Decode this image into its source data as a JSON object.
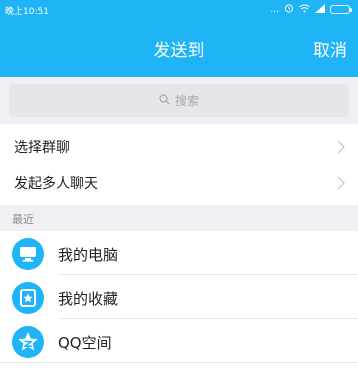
{
  "status": {
    "time": "晚上10:51",
    "signal_text": "..."
  },
  "header": {
    "title": "发送到",
    "cancel": "取消"
  },
  "search": {
    "placeholder": "搜索"
  },
  "rows": [
    {
      "label": "选择群聊"
    },
    {
      "label": "发起多人聊天"
    }
  ],
  "section": {
    "label": "最近"
  },
  "recent": [
    {
      "label": "我的电脑",
      "icon": "computer-icon"
    },
    {
      "label": "我的收藏",
      "icon": "favorites-icon"
    },
    {
      "label": "QQ空间",
      "icon": "qzone-star-icon"
    }
  ],
  "colors": {
    "primary": "#1eb4f5",
    "separator_bg": "#f0f0f4"
  }
}
